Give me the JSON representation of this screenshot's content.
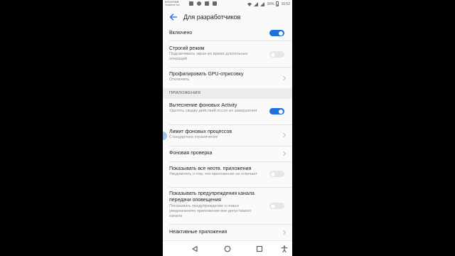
{
  "status_bar": {
    "operator_1": "KYIVSTAR",
    "operator_2": "Vodafone UA",
    "battery": "16%",
    "time": "16:52"
  },
  "app_bar": {
    "title": "Для разработчиков",
    "back_icon": "arrow-left-icon"
  },
  "colors": {
    "accent": "#1e6fd9",
    "background": "#fafafa",
    "section_bg": "#ececec"
  },
  "settings": {
    "enabled": {
      "title": "Включено",
      "toggle": "on"
    },
    "strict_mode": {
      "title": "Строгий режим",
      "subtitle": "Подсвечивать экран во время длительных операций",
      "toggle": "off"
    },
    "gpu_profiling": {
      "title": "Профилировать GPU-отрисовку",
      "subtitle": "Отключить"
    },
    "apps_section": {
      "label": "ПРИЛОЖЕНИЯ"
    },
    "bg_activity": {
      "title": "Вытеснение фоновых Activity",
      "subtitle": "Удалять сводку действий после их завершения",
      "toggle": "on"
    },
    "bg_process_limit": {
      "title": "Лимит фоновых процессов",
      "subtitle": "Стандартное ограничение"
    },
    "bg_check": {
      "title": "Фоновая проверка"
    },
    "show_all_anr": {
      "title": "Показывать все неотв. приложения",
      "subtitle": "Уведомлять о том, что приложение не отвечает",
      "toggle": "off"
    },
    "channel_warnings": {
      "title": "Показывать предупреждения канала передачи оповещения",
      "subtitle": "Показывать предупреждение о новых уведомлениях приложения вне допустимого канала",
      "toggle": "off"
    },
    "inactive_apps": {
      "title": "Неактивные приложения"
    }
  },
  "nav_bar": {
    "icons": [
      "back-triangle-icon",
      "home-circle-icon",
      "recents-square-icon",
      "accessibility-icon"
    ]
  }
}
